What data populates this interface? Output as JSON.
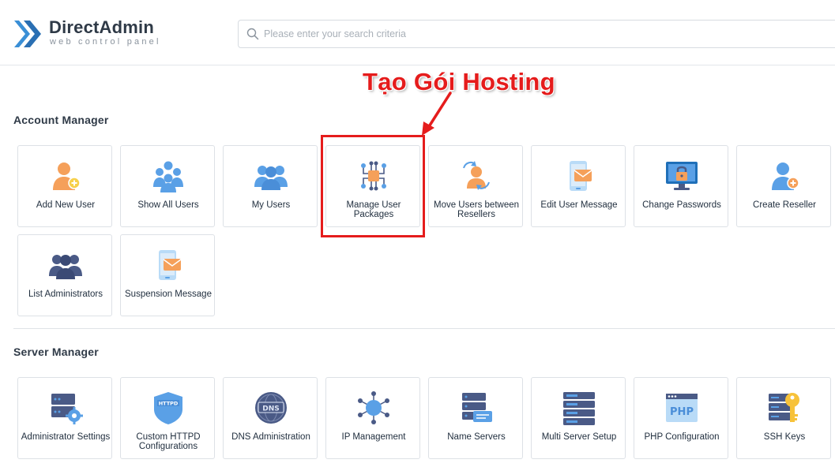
{
  "app": {
    "name": "DirectAdmin",
    "tagline": "web control panel"
  },
  "search": {
    "placeholder": "Please enter your search criteria"
  },
  "annotation": {
    "text": "Tạo Gói Hosting",
    "color": "#e51c1c"
  },
  "account_manager": {
    "title": "Account Manager",
    "tiles": [
      {
        "label": "Add New User",
        "icon": "add-user-icon"
      },
      {
        "label": "Show All Users",
        "icon": "users-group-icon"
      },
      {
        "label": "My Users",
        "icon": "my-users-icon"
      },
      {
        "label": "Manage User Packages",
        "icon": "packages-icon"
      },
      {
        "label": "Move Users between Resellers",
        "icon": "move-users-icon"
      },
      {
        "label": "Edit User Message",
        "icon": "mobile-message-icon"
      },
      {
        "label": "Change Passwords",
        "icon": "password-lock-icon"
      },
      {
        "label": "Create Reseller",
        "icon": "create-reseller-icon"
      },
      {
        "label": "List Administrators",
        "icon": "administrators-icon"
      },
      {
        "label": "Suspension Message",
        "icon": "suspension-message-icon"
      }
    ]
  },
  "server_manager": {
    "title": "Server Manager",
    "tiles": [
      {
        "label": "Administrator Settings",
        "icon": "admin-settings-icon"
      },
      {
        "label": "Custom HTTPD Configurations",
        "icon": "httpd-badge-icon"
      },
      {
        "label": "DNS Administration",
        "icon": "dns-globe-icon"
      },
      {
        "label": "IP Management",
        "icon": "ip-network-icon"
      },
      {
        "label": "Name Servers",
        "icon": "name-servers-icon"
      },
      {
        "label": "Multi Server Setup",
        "icon": "multi-server-icon"
      },
      {
        "label": "PHP Configuration",
        "icon": "php-icon"
      },
      {
        "label": "SSH Keys",
        "icon": "ssh-keys-icon"
      }
    ],
    "httpd_badge_text": "HTTPD",
    "dns_badge_text": "DNS",
    "php_badge_text": "PHP"
  },
  "colors": {
    "orange": "#f5a05a",
    "blue": "#5aa0e6",
    "navy": "#4a5a86",
    "annotation_red": "#e51c1c"
  }
}
